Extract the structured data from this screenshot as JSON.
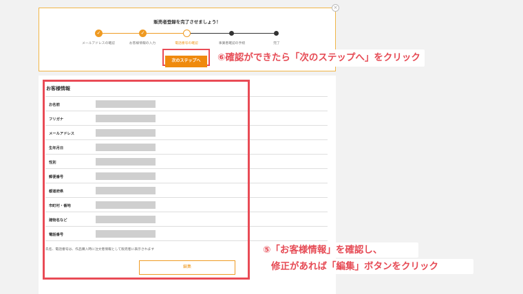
{
  "progress": {
    "title": "販売者登録を完了させましょう！",
    "steps": [
      {
        "label": "メールアドレスの確認",
        "state": "done"
      },
      {
        "label": "お客様情報の入力",
        "state": "done"
      },
      {
        "label": "電話番号の確認",
        "state": "current"
      },
      {
        "label": "事業者確認の手続",
        "state": "todo"
      },
      {
        "label": "完了",
        "state": "todo"
      }
    ],
    "check_glyph": "✓",
    "next_button": "次のステップへ"
  },
  "customer_info": {
    "title": "お客様情報",
    "rows": [
      {
        "label": "お名前"
      },
      {
        "label": "フリガナ"
      },
      {
        "label": "メールアドレス"
      },
      {
        "label": "生年月日"
      },
      {
        "label": "性別"
      },
      {
        "label": "郵便番号"
      },
      {
        "label": "都道府県"
      },
      {
        "label": "市町村・番地"
      },
      {
        "label": "建物名など"
      },
      {
        "label": "電話番号"
      }
    ],
    "note": "氏名、電話番号は、作品購入時に注文者情報として販売者に表示されます",
    "edit_button": "編集"
  },
  "annotations": {
    "step6": "⑥確認ができたら「次のステップへ」をクリック",
    "step5_line1": "⑤「お客様情報」を確認し、",
    "step5_line2": "修正があれば「編集」ボタンをクリック"
  },
  "colors": {
    "accent": "#ef9a21",
    "highlight": "#e94b56"
  }
}
